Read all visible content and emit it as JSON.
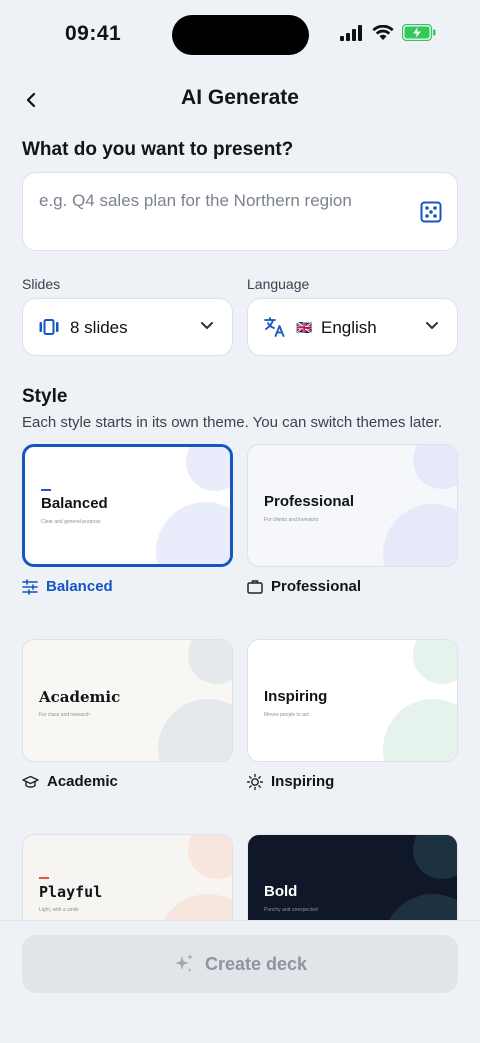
{
  "status": {
    "time": "09:41"
  },
  "header": {
    "title": "AI Generate"
  },
  "prompt": {
    "question": "What do you want to present?",
    "placeholder": "e.g. Q4 sales plan for the Northern region",
    "value": ""
  },
  "slides": {
    "label": "Slides",
    "value": "8 slides"
  },
  "language": {
    "label": "Language",
    "flag": "🇬🇧",
    "value": "English"
  },
  "style": {
    "title": "Style",
    "subtitle": "Each style starts in its own theme. You can switch themes later.",
    "selected": "Balanced",
    "options": [
      {
        "name": "Balanced",
        "tagline": "Clear and general-purpose",
        "icon": "sliders-icon",
        "bg": "#ffffff",
        "blob": "#e8ecfb",
        "title_color": "#111418",
        "accent": "#2a55c8"
      },
      {
        "name": "Professional",
        "tagline": "For clients and investors",
        "icon": "briefcase-icon",
        "bg": "#f5f7fb",
        "blob": "#e5e9f9",
        "title_color": "#111418",
        "accent": ""
      },
      {
        "name": "Academic",
        "tagline": "For class and research",
        "icon": "graduation-cap-icon",
        "bg": "#f8f7f4",
        "blob": "#e6e9ec",
        "title_color": "#111418",
        "accent": ""
      },
      {
        "name": "Inspiring",
        "tagline": "Moves people to act",
        "icon": "sun-icon",
        "bg": "#ffffff",
        "blob": "#e6f2ec",
        "title_color": "#111418",
        "accent": ""
      },
      {
        "name": "Playful",
        "tagline": "Light, with a smile",
        "icon": "",
        "bg": "#f7f5f1",
        "blob": "#f8e5dd",
        "title_color": "#111418",
        "accent": "#e2574c"
      },
      {
        "name": "Bold",
        "tagline": "Punchy and unexpected",
        "icon": "",
        "bg": "#0f1729",
        "blob": "#1d3240",
        "title_color": "#ffffff",
        "accent": ""
      }
    ]
  },
  "cta": {
    "label": "Create deck",
    "enabled": false
  }
}
